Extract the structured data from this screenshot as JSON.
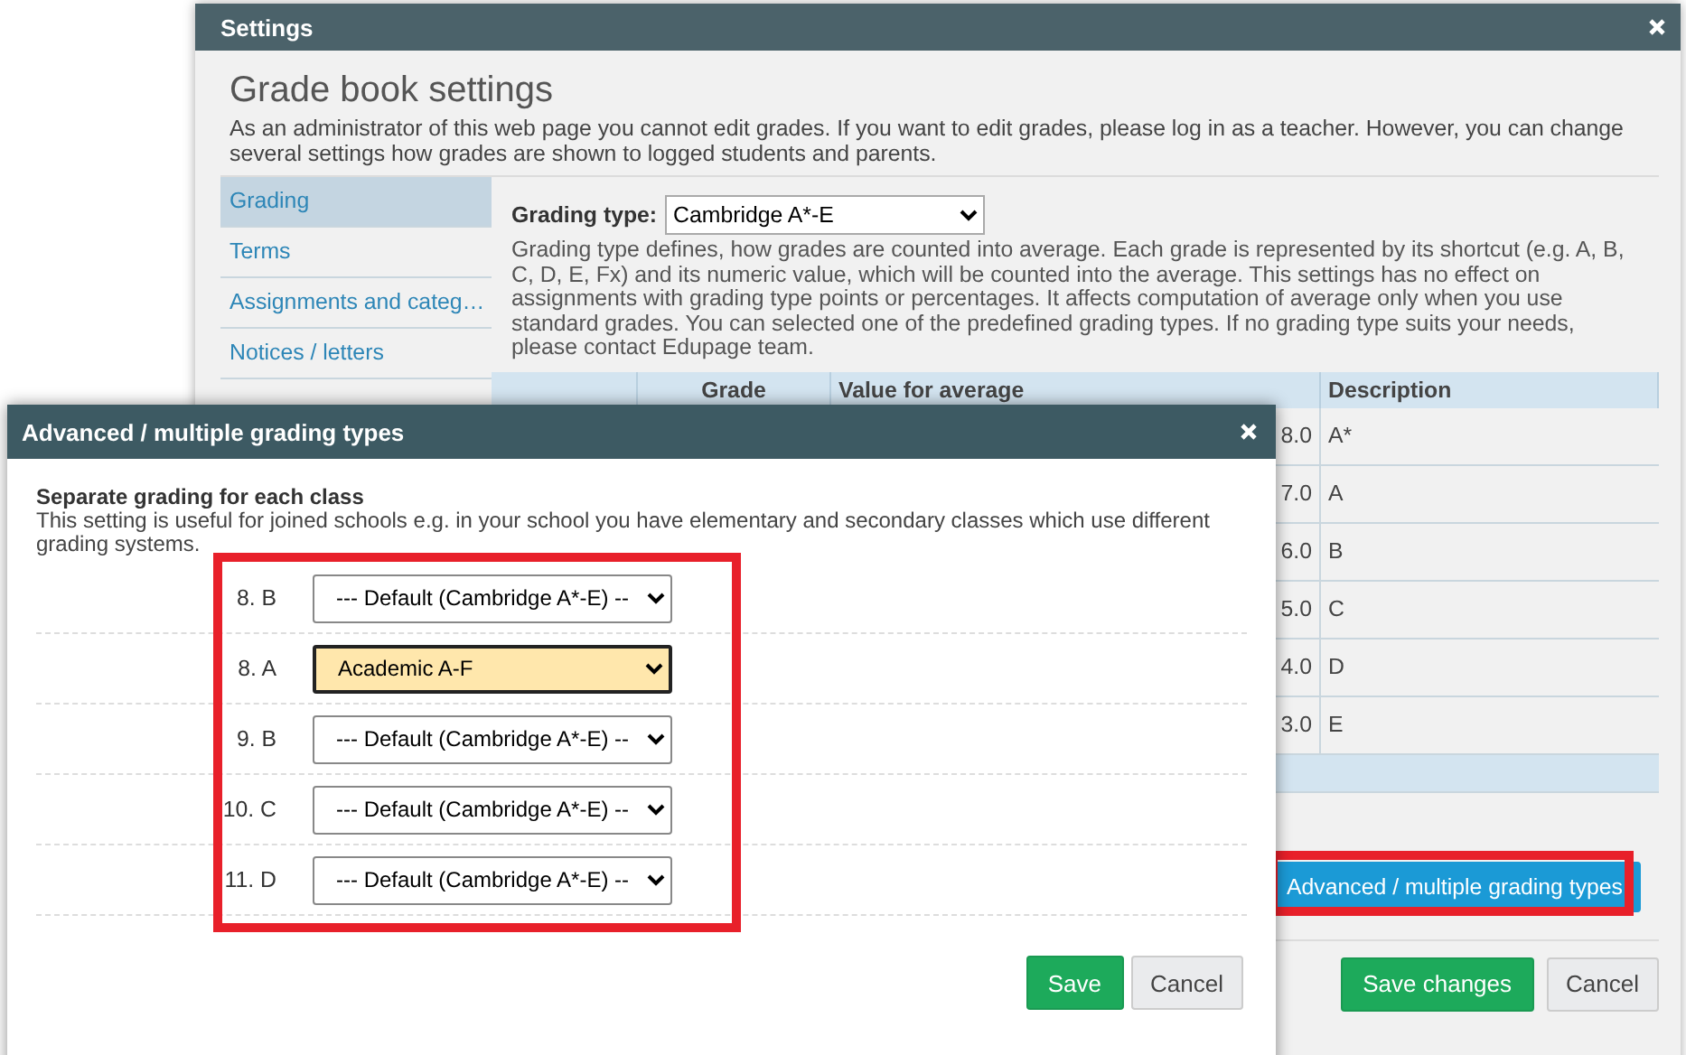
{
  "settings_window": {
    "title": "Settings",
    "heading": "Grade book settings",
    "intro": "As an administrator of this web page you cannot edit grades. If you want to edit grades, please log in as a teacher. However, you can change several settings how grades are shown to logged students and parents.",
    "sidebar": {
      "items": [
        {
          "label": "Grading",
          "selected": true
        },
        {
          "label": "Terms",
          "selected": false
        },
        {
          "label": "Assignments and categ…",
          "selected": false
        },
        {
          "label": "Notices / letters",
          "selected": false
        }
      ]
    },
    "grading_type": {
      "label": "Grading type:",
      "value": "Cambridge A*-E"
    },
    "grading_type_help": "Grading type defines, how grades are counted into average. Each grade is represented by its shortcut (e.g. A, B, C, D, E, Fx) and its numeric value, which will be counted into the average. This settings has no effect on assignments with grading type points or percentages. It affects computation of average only when you use standard grades. You can selected one of the predefined grading types. If no grading type suits your needs, please contact Edupage team.",
    "table": {
      "columns": [
        "Grade",
        "Value for average",
        "Description"
      ],
      "rows": [
        {
          "value": "8.0",
          "description": "A*"
        },
        {
          "value": "7.0",
          "description": "A"
        },
        {
          "value": "6.0",
          "description": "B"
        },
        {
          "value": "5.0",
          "description": "C"
        },
        {
          "value": "4.0",
          "description": "D"
        },
        {
          "value": "3.0",
          "description": "E"
        }
      ]
    },
    "advanced_button": {
      "label": "Advanced / multiple grading types",
      "highlighted": true
    },
    "buttons": [
      {
        "label": "Save changes",
        "kind": "primary"
      },
      {
        "label": "Cancel",
        "kind": "secondary"
      }
    ]
  },
  "dialog": {
    "title": "Advanced / multiple grading types",
    "heading": "Separate grading for each class",
    "description": "This setting is useful for joined schools e.g. in your school you have elementary and secondary classes which use different grading systems.",
    "classes_highlighted": true,
    "classes": [
      {
        "label": "8. B",
        "value": "--- Default (Cambridge A*-E) --",
        "focused": false
      },
      {
        "label": "8. A",
        "value": "Academic A-F",
        "focused": true
      },
      {
        "label": "9. B",
        "value": "--- Default (Cambridge A*-E) --",
        "focused": false
      },
      {
        "label": "10. C",
        "value": "--- Default (Cambridge A*-E) --",
        "focused": false
      },
      {
        "label": "11. D",
        "value": "--- Default (Cambridge A*-E) --",
        "focused": false
      }
    ],
    "buttons": [
      {
        "label": "Save",
        "kind": "primary"
      },
      {
        "label": "Cancel",
        "kind": "secondary"
      }
    ]
  }
}
